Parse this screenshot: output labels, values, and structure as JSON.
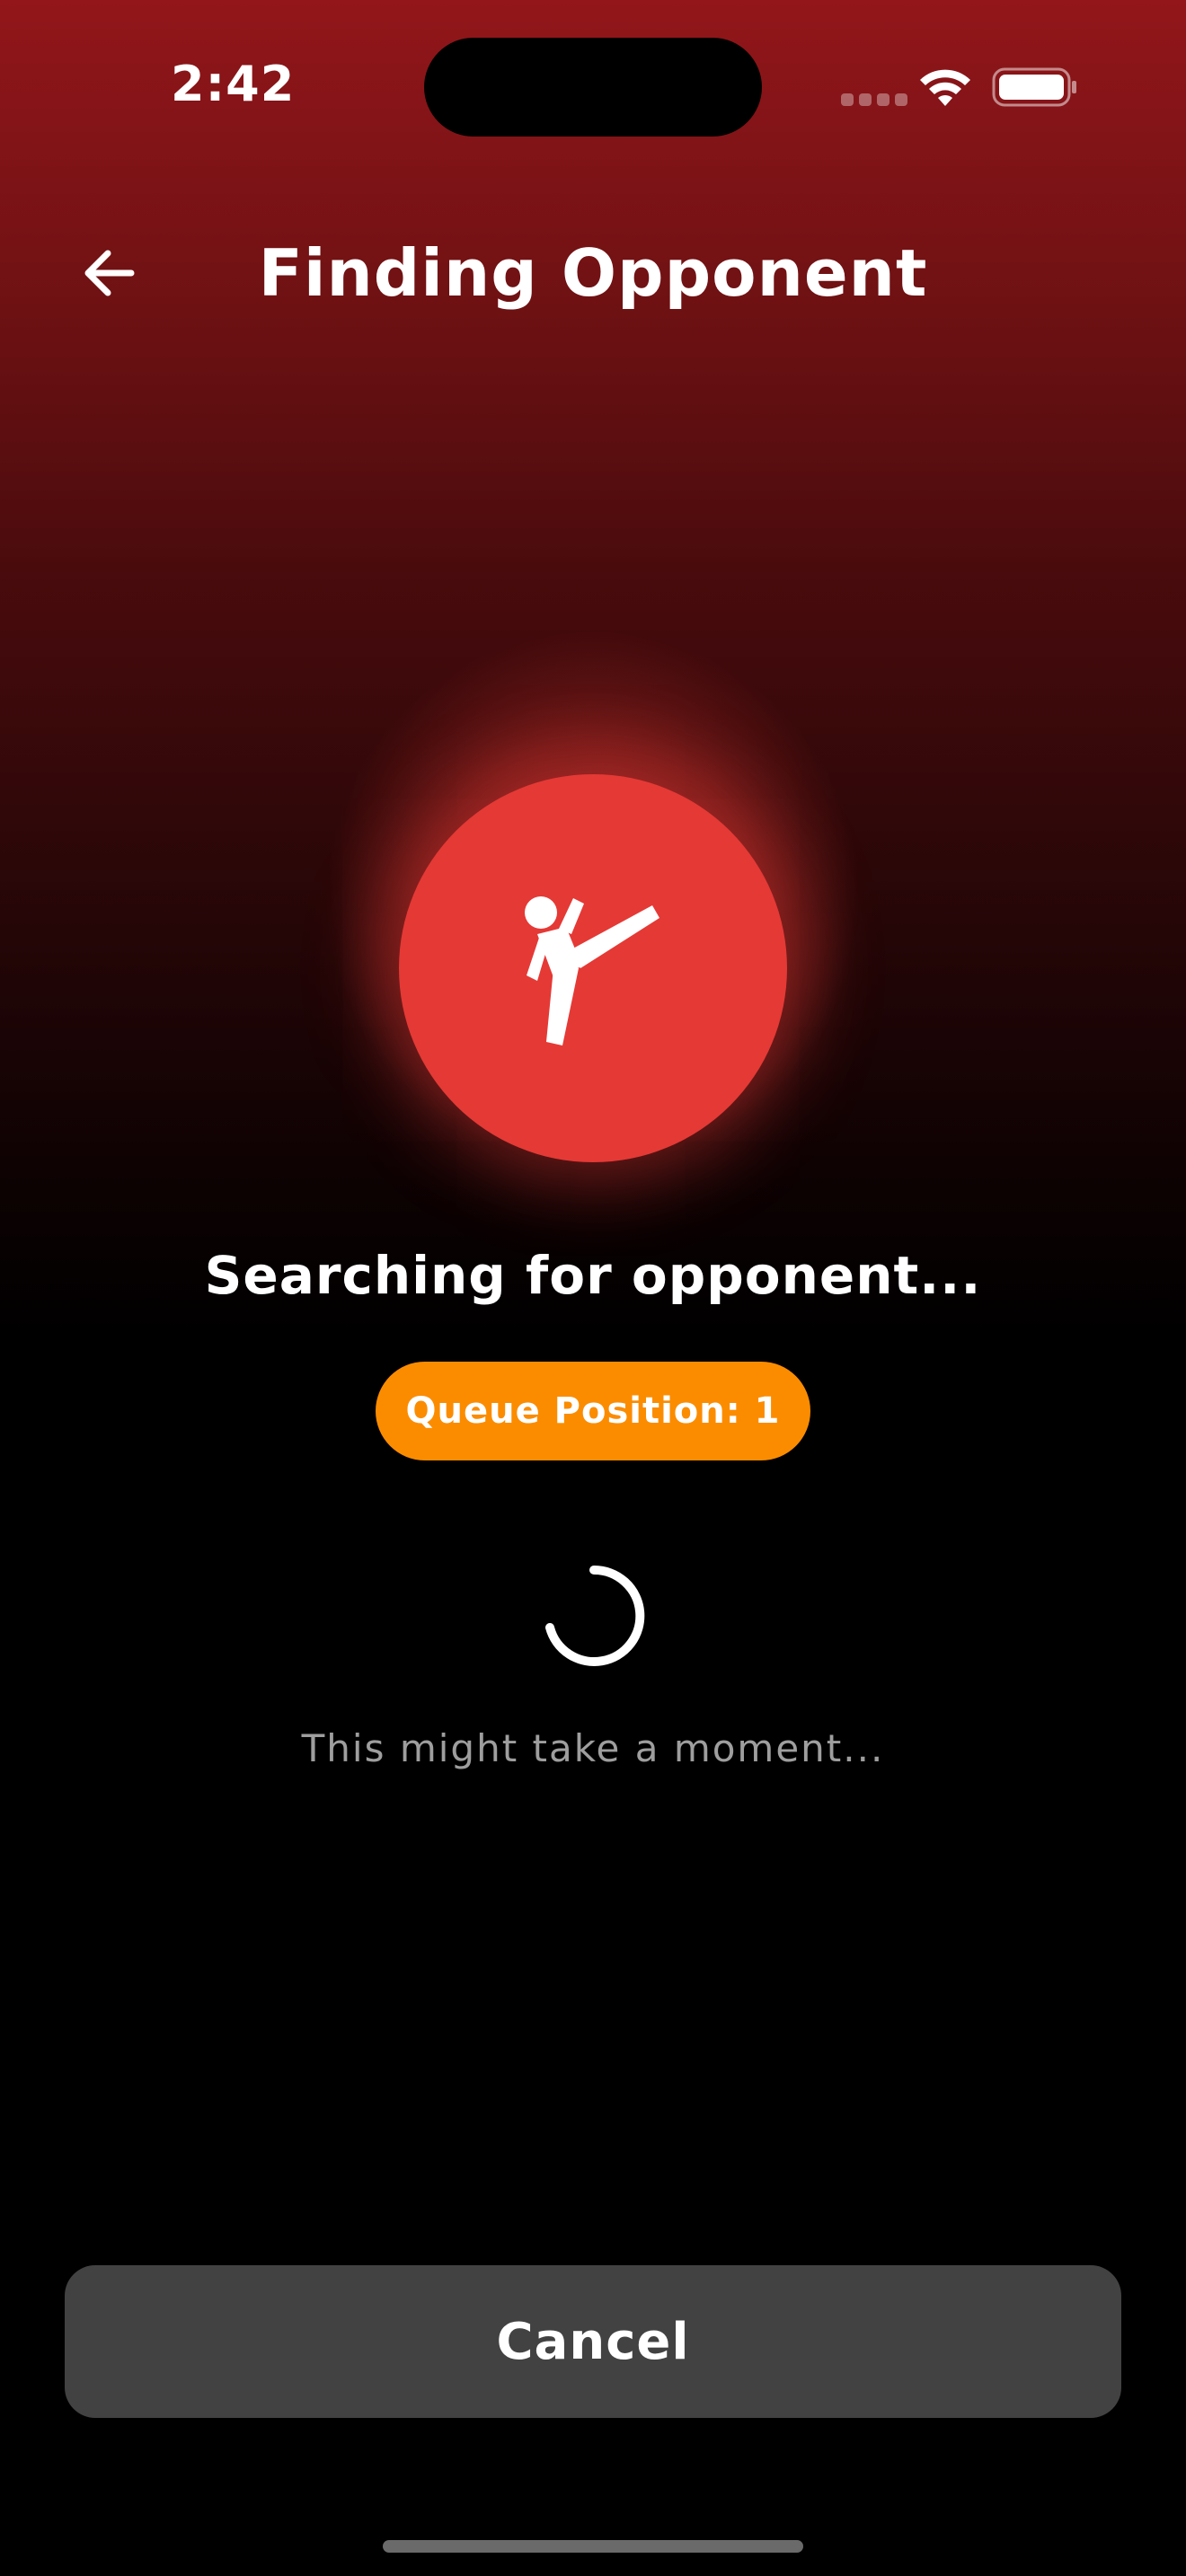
{
  "status_bar": {
    "time": "2:42"
  },
  "header": {
    "title": "Finding Opponent",
    "back_icon": "arrow-left-icon"
  },
  "hero": {
    "icon": "martial-arts-kick-icon",
    "circle_color": "#e53935"
  },
  "status": {
    "searching_text": "Searching for opponent...",
    "queue_label": "Queue Position: 1",
    "queue_color": "#fb8c00",
    "hint_text": "This might take a moment..."
  },
  "actions": {
    "cancel_label": "Cancel",
    "cancel_color": "#424242"
  },
  "theme": {
    "gradient_top": "#92161a",
    "background": "#000000"
  }
}
